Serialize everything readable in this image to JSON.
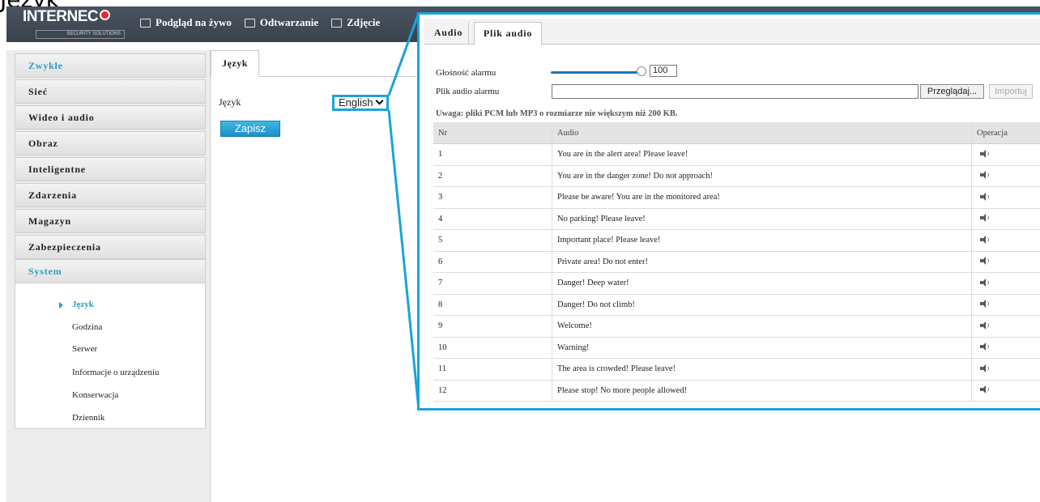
{
  "page_caption": "Język",
  "brand": {
    "name": "INTERNEC",
    "tagline": "SECURITY SOLUTIONS",
    "accent": "#1aa3dd"
  },
  "topnav": [
    {
      "label": "Podgląd na żywo",
      "icon": "monitor-icon"
    },
    {
      "label": "Odtwarzanie",
      "icon": "film-icon"
    },
    {
      "label": "Zdjęcie",
      "icon": "image-icon"
    }
  ],
  "sidebar": {
    "items": [
      {
        "label": "Zwykłe"
      },
      {
        "label": "Sieć"
      },
      {
        "label": "Wideo i audio"
      },
      {
        "label": "Obraz"
      },
      {
        "label": "Inteligentne"
      },
      {
        "label": "Zdarzenia"
      },
      {
        "label": "Magazyn"
      },
      {
        "label": "Zabezpieczenia"
      },
      {
        "label": "System"
      }
    ],
    "submenu": [
      {
        "label": "Język"
      },
      {
        "label": "Godzina"
      },
      {
        "label": "Serwer"
      },
      {
        "label": "Informacje o urządzeniu"
      },
      {
        "label": "Konserwacja"
      },
      {
        "label": "Dziennik"
      }
    ]
  },
  "language_panel": {
    "tab": "Język",
    "field_label": "Język",
    "selected_language": "English",
    "save_label": "Zapisz"
  },
  "audio_panel": {
    "tabs": [
      "Audio",
      "Plik audio"
    ],
    "volume_label": "Głośność alarmu",
    "volume_value": "100",
    "volume_fraction": 1.0,
    "file_label": "Plik audio alarmu",
    "browse_label": "Przeglądaj...",
    "import_label": "Importuj",
    "note": "Uwaga: pliki PCM lub MP3 o rozmiarze nie większym niż 200 KB.",
    "columns": [
      "Nr",
      "Audio",
      "Operacja"
    ],
    "rows": [
      {
        "nr": "1",
        "audio": "You are in the alert area! Please leave!"
      },
      {
        "nr": "2",
        "audio": "You are in the danger zone! Do not approach!"
      },
      {
        "nr": "3",
        "audio": "Please be aware! You are in the monitored area!"
      },
      {
        "nr": "4",
        "audio": "No parking! Please leave!"
      },
      {
        "nr": "5",
        "audio": "Important place! Please leave!"
      },
      {
        "nr": "6",
        "audio": "Private area! Do not enter!"
      },
      {
        "nr": "7",
        "audio": "Danger! Deep water!"
      },
      {
        "nr": "8",
        "audio": "Danger! Do not climb!"
      },
      {
        "nr": "9",
        "audio": "Welcome!"
      },
      {
        "nr": "10",
        "audio": "Warning!"
      },
      {
        "nr": "11",
        "audio": "The area is crowded! Please leave!"
      },
      {
        "nr": "12",
        "audio": "Please stop! No more people allowed!"
      }
    ]
  }
}
